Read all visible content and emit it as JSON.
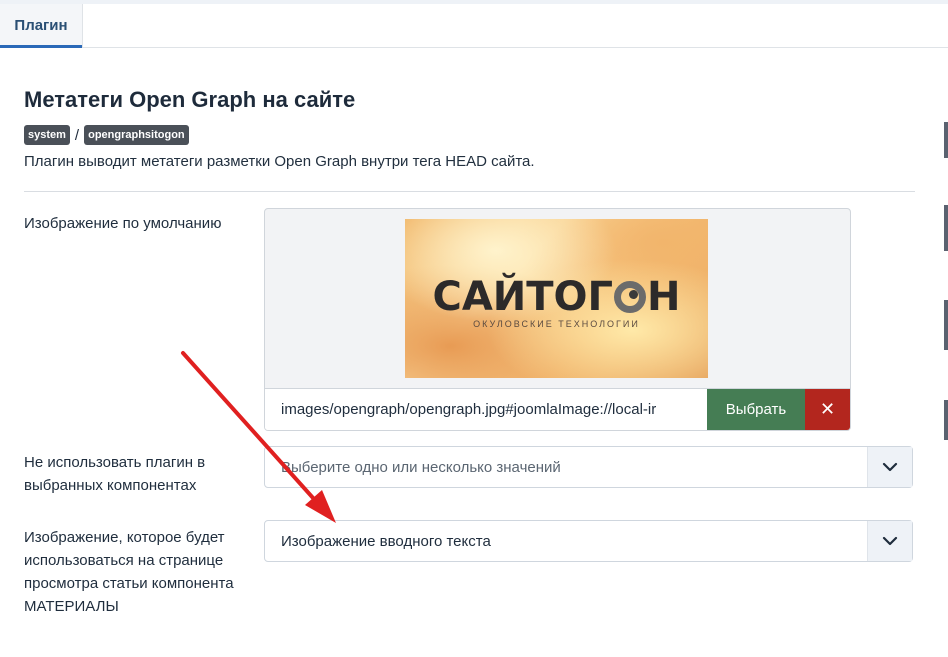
{
  "tabs": [
    {
      "label": "Плагин"
    }
  ],
  "header": {
    "title": "Метатеги Open Graph на сайте",
    "badges": [
      "system",
      "opengraphsitogon"
    ],
    "separator": "/",
    "description": "Плагин выводит метатеги разметки Open Graph внутри тега HEAD сайта."
  },
  "fields": {
    "default_image": {
      "label": "Изображение по умолчанию",
      "preview": {
        "logo_main_left": "САЙТОГ",
        "logo_main_right": "Н",
        "logo_sub": "ОКУЛОВСКИЕ ТЕХНОЛОГИИ"
      },
      "path_value": "images/opengraph/opengraph.jpg#joomlaImage://local-ir",
      "select_label": "Выбрать",
      "clear_label": "✕"
    },
    "exclude_components": {
      "label": "Не использовать плагин в выбранных компонентах",
      "placeholder": "Выберите одно или несколько значений"
    },
    "article_image": {
      "label": "Изображение, которое будет использоваться на странице просмотра статьи компонента МАТЕРИАЛЫ",
      "value": "Изображение вводного текста"
    }
  },
  "colors": {
    "select_button": "#457d54",
    "clear_button": "#b3261e",
    "annotation_arrow": "#e02020"
  },
  "icons": {
    "dropdown": "chevron-down-icon",
    "clear": "close-icon"
  }
}
